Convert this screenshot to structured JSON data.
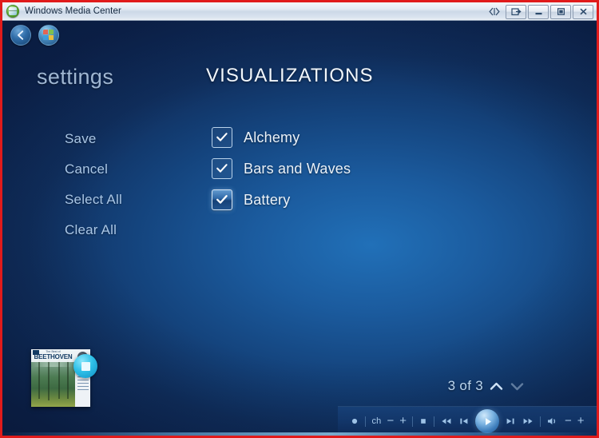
{
  "window": {
    "title": "Windows Media Center",
    "app_icon": "windows-media-center-orb-icon",
    "controls": {
      "media_nav_label": "media-nav-icon",
      "restore_group_label": "restore-window-icon",
      "minimize_label": "minimize-icon",
      "maximize_label": "maximize-icon",
      "close_label": "close-icon"
    }
  },
  "nav": {
    "back_label": "back-arrow-icon",
    "home_label": "windows-start-icon"
  },
  "header": {
    "section": "settings",
    "title": "VISUALIZATIONS"
  },
  "menu": {
    "items": [
      {
        "label": "Save"
      },
      {
        "label": "Cancel"
      },
      {
        "label": "Select All"
      },
      {
        "label": "Clear All"
      }
    ]
  },
  "visualizations": {
    "items": [
      {
        "label": "Alchemy",
        "checked": true,
        "focused": false
      },
      {
        "label": "Bars and Waves",
        "checked": true,
        "focused": false
      },
      {
        "label": "Battery",
        "checked": true,
        "focused": true
      }
    ]
  },
  "pager": {
    "count_text": "3 of 3",
    "up_label": "chevron-up-icon",
    "down_label": "chevron-down-icon"
  },
  "now_playing": {
    "album_subtitle": "The Best of",
    "album_title": "BEETHOVEN",
    "badge_label": "stop-badge-icon"
  },
  "transport": {
    "record_label": "record-icon",
    "channel_label": "ch",
    "channel_down_label": "−",
    "channel_up_label": "+",
    "stop_label": "stop-icon",
    "rewind_label": "rewind-icon",
    "previous_label": "previous-track-icon",
    "play_label": "play-icon",
    "next_label": "next-track-icon",
    "forward_label": "fast-forward-icon",
    "volume_label": "volume-icon",
    "volume_down_label": "−",
    "volume_up_label": "+"
  },
  "colors": {
    "accent": "#2170b8",
    "menu_text": "#a9c6e6",
    "title_text": "#f2f7fc",
    "badge": "#2fc0e8",
    "frame": "#e01b1b"
  }
}
